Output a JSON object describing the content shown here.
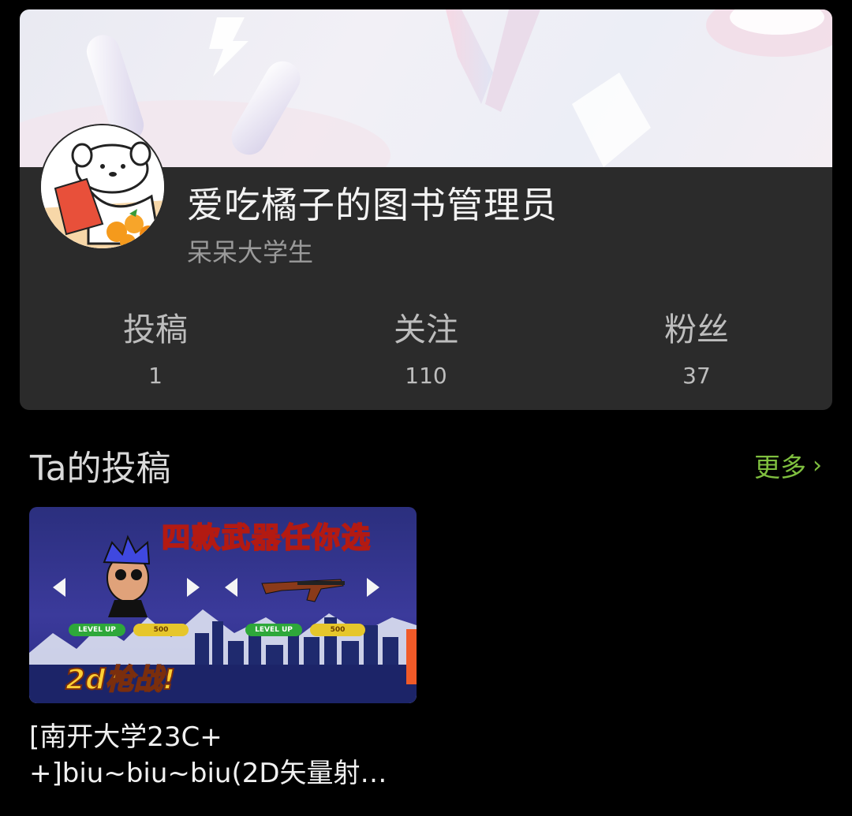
{
  "profile": {
    "name": "爱吃橘子的图书管理员",
    "sign": "呆呆大学生",
    "stats": [
      {
        "label": "投稿",
        "value": "1"
      },
      {
        "label": "关注",
        "value": "110"
      },
      {
        "label": "粉丝",
        "value": "37"
      }
    ]
  },
  "section": {
    "title": "Ta的投稿",
    "more_label": "更多",
    "more_icon": "chevron-right-icon"
  },
  "video": {
    "thumb_banner_text": "四款武器任你选",
    "thumb_title_text": "2d枪战!",
    "pill_level": "LEVEL UP",
    "pill_price": "500",
    "title_line1": "[南开大学23C+",
    "title_line2": "+]biu~biu~biu(2D矢量射…"
  },
  "colors": {
    "background": "#000000",
    "card": "#2b2b2b",
    "accent_green": "#7fbf3f",
    "text_primary": "#f3f3f3",
    "text_secondary": "#9a9a9a"
  }
}
